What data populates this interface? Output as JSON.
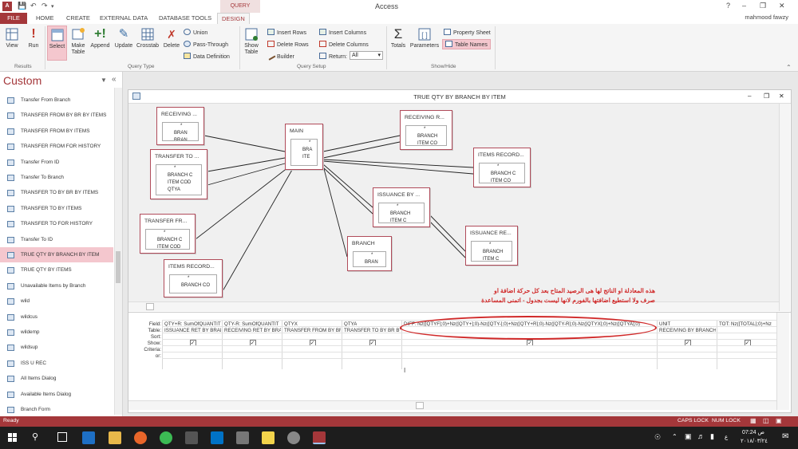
{
  "titlebar": {
    "app_icon": "A",
    "title": "Access",
    "context_tab": "QUERY TOOLS",
    "user": "mahmood fawzy"
  },
  "tabs": [
    "FILE",
    "HOME",
    "CREATE",
    "EXTERNAL DATA",
    "DATABASE TOOLS",
    "DESIGN"
  ],
  "ribbon": {
    "results": {
      "view": "View",
      "run": "Run",
      "label": "Results"
    },
    "query_type": {
      "select": "Select",
      "make_table": "Make Table",
      "append": "Append",
      "update": "Update",
      "crosstab": "Crosstab",
      "delete": "Delete",
      "union": "Union",
      "pass_through": "Pass-Through",
      "data_definition": "Data Definition",
      "label": "Query Type"
    },
    "query_setup": {
      "show_table": "Show Table",
      "insert_rows": "Insert Rows",
      "delete_rows": "Delete Rows",
      "builder": "Builder",
      "insert_columns": "Insert Columns",
      "delete_columns": "Delete Columns",
      "return_label": "Return:",
      "return_value": "All",
      "label": "Query Setup"
    },
    "show_hide": {
      "totals": "Totals",
      "parameters": "Parameters",
      "property_sheet": "Property Sheet",
      "table_names": "Table Names",
      "label": "Show/Hide"
    }
  },
  "nav": {
    "title": "Custom",
    "items": [
      "Transfer From Branch",
      "TRANSFER FROM BY BR BY ITEMS",
      "TRANSFER FROM BY ITEMS",
      "TRANSFER FROM FOR HISTORY",
      "Transfer From ID",
      "Transfer To Branch",
      "TRANSFER TO BY BR BY ITEMS",
      "TRANSFER TO BY ITEMS",
      "TRANSFER TO FOR HISTORY",
      "Transfer To ID",
      "TRUE QTY BY BRANCH BY ITEM",
      "TRUE QTY BY ITEMS",
      "Unavailable Items by Branch",
      "wild",
      "wildcus",
      "wildemp",
      "wildsup",
      "ISS U REC",
      "All Items Dialog",
      "Available Items Dialog",
      "Branch Form"
    ],
    "selected": "TRUE QTY BY BRANCH BY ITEM"
  },
  "doc": {
    "title": "TRUE QTY BY BRANCH BY ITEM",
    "tables": [
      {
        "title": "RECEIVING ...",
        "fields": [
          "*",
          "BRAN",
          "BRAN"
        ]
      },
      {
        "title": "TRANSFER TO ...",
        "fields": [
          "*",
          "BRANCH C",
          "ITEM COD",
          "QTYA"
        ]
      },
      {
        "title": "TRANSFER FR...",
        "fields": [
          "*",
          "BRANCH C",
          "ITEM COD"
        ]
      },
      {
        "title": "ITEMS RECORD...",
        "fields": [
          "*",
          "BRANCH CO"
        ]
      },
      {
        "title": "MAIN",
        "fields": [
          "*",
          "BRA",
          "ITE"
        ]
      },
      {
        "title": "RECEIVING R...",
        "fields": [
          "*",
          "BRANCH",
          "ITEM CO"
        ]
      },
      {
        "title": "ITEMS RECORD...",
        "fields": [
          "*",
          "BRANCH C",
          "ITEM CO"
        ]
      },
      {
        "title": "ISSUANCE BY ...",
        "fields": [
          "*",
          "BRANCH",
          "ITEM C"
        ]
      },
      {
        "title": "BRANCH",
        "fields": [
          "*",
          "BRAN"
        ]
      },
      {
        "title": "ISSUANCE RE...",
        "fields": [
          "*",
          "BRANCH",
          "ITEM C"
        ]
      }
    ],
    "annotation_line1": "هذه المعادلة او الناتج لها هى الرصيد المتاح بعد كل حركة اضافة او",
    "annotation_line2": "صرف ولا استطيع اضافتها بالفورم لانها ليست بجدول - اتمنى المساعدة",
    "grid": {
      "row_labels": [
        "Field:",
        "Table:",
        "Sort:",
        "Show:",
        "Criteria:",
        "or:"
      ],
      "columns": [
        {
          "field": "QTY+R: SumOfQUANTIT",
          "table": "ISSUANCE RET BY BRAN",
          "show": true
        },
        {
          "field": "QTY-R: SumOfQUANTIT",
          "table": "RECEIVING RET BY BRAI",
          "show": true
        },
        {
          "field": "QTYX",
          "table": "TRANSFER FROM BY BR",
          "show": true
        },
        {
          "field": "QTYA",
          "table": "TRANSFER TO BY BR BY",
          "show": true
        },
        {
          "field": "DIFF: Nz([QTYF];0)+Nz([QTY+];0)-Nz([QTY-];0)+Nz([QTY+R];0)-Nz([QTY-R];0)-Nz([QTYX];0)+Nz([QTYA];0)",
          "table": "",
          "show": true
        },
        {
          "field": "UNIT",
          "table": "RECEIVING BY BRANCH",
          "show": true
        },
        {
          "field": "TOT: Nz([TOTAL];0)+Nz",
          "table": "",
          "show": true
        }
      ]
    }
  },
  "status": {
    "left": "Ready",
    "caps": "CAPS LOCK",
    "num": "NUM LOCK"
  },
  "taskbar": {
    "time": "07:24 ص",
    "date": "٢٠١٨/٠٣/٢٤",
    "lang": "ع"
  },
  "colors": {
    "accent": "#a4373a",
    "annotation": "#d02828",
    "selected_nav": "#f4c7ce"
  }
}
